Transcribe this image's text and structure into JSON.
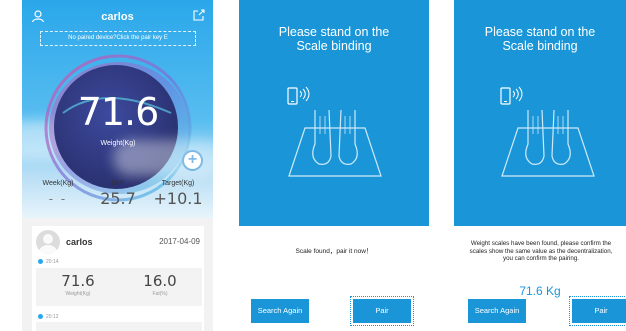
{
  "screen1": {
    "title": "carlos",
    "notice": "No paired device?Click the pair key  E",
    "weight_value": "71.6",
    "weight_label": "Weight(Kg)",
    "stats": [
      {
        "label": "Week(Kg)",
        "value": "- -"
      },
      {
        "label": "BMI",
        "value": "25.7"
      },
      {
        "label": "Target(Kg)",
        "value": "+10.1"
      }
    ],
    "plus_label": "+",
    "card": {
      "name": "carlos",
      "date": "2017-04-09",
      "time1": "20:14",
      "time2": "20:12",
      "weight_value": "71.6",
      "weight_label": "Weight(Kg)",
      "fat_value": "16.0",
      "fat_label": "Fat(%)"
    }
  },
  "screen2": {
    "title_line1": "Please stand on the",
    "title_line2": "Scale binding",
    "message": "Scale found，pair it now！",
    "search_again": "Search Again",
    "pair": "Pair"
  },
  "screen3": {
    "title_line1": "Please stand on the",
    "title_line2": "Scale binding",
    "message": "Weight scales have been found, please confirm the scales show the same value as the decentralization, you can confirm the pairing.",
    "weight": "71.6 Kg",
    "search_again": "Search Again",
    "pair": "Pair"
  },
  "colors": {
    "primary_blue": "#1a96d8",
    "sky_blue": "#2aa7ea",
    "ring_purple": "#3a3f8f"
  }
}
